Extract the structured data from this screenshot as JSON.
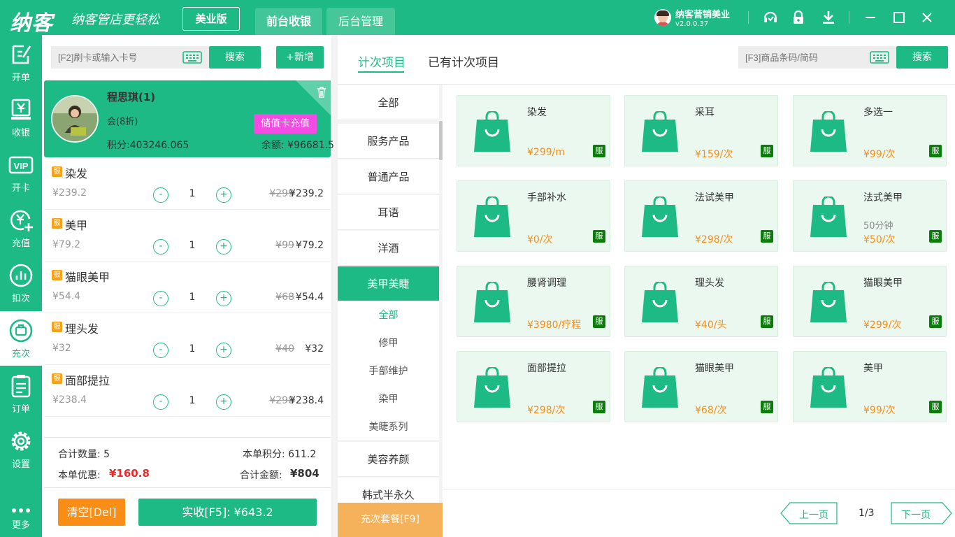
{
  "topbar": {
    "logo": "纳客",
    "slogan": "纳客管店更轻松",
    "edition": "美业版",
    "tabs": [
      {
        "label": "前台收银"
      },
      {
        "label": "后台管理"
      }
    ],
    "user_name": "纳客营销美业",
    "version": "v2.0.0.37"
  },
  "nav": [
    {
      "label": "开单",
      "icon": "edit-doc-icon"
    },
    {
      "label": "收银",
      "icon": "cash-icon"
    },
    {
      "label": "开卡",
      "icon": "vip-card-icon"
    },
    {
      "label": "充值",
      "icon": "recharge-icon"
    },
    {
      "label": "扣次",
      "icon": "chart-icon"
    },
    {
      "label": "充次",
      "icon": "refill-icon"
    },
    {
      "label": "订单",
      "icon": "order-icon"
    },
    {
      "label": "设置",
      "icon": "gear-icon"
    },
    {
      "label": "更多",
      "icon": "more-icon"
    }
  ],
  "cart": {
    "card_placeholder": "[F2]刷卡或输入卡号",
    "search_label": "搜索",
    "new_label": "+新增",
    "member": {
      "name": "程思琪(1)",
      "level": "会(8折)",
      "points": "积分:403246.065",
      "balance": "余额: ¥96681.5",
      "recharge_label": "储值卡充值"
    },
    "items": [
      {
        "badge": "服",
        "name": "染发",
        "price": "¥239.2",
        "qty": "1",
        "orig": "¥299",
        "final": "¥239.2"
      },
      {
        "badge": "服",
        "name": "美甲",
        "price": "¥79.2",
        "qty": "1",
        "orig": "¥99",
        "final": "¥79.2"
      },
      {
        "badge": "服",
        "name": "猫眼美甲",
        "price": "¥54.4",
        "qty": "1",
        "orig": "¥68",
        "final": "¥54.4"
      },
      {
        "badge": "服",
        "name": "理头发",
        "price": "¥32",
        "qty": "1",
        "orig": "¥40",
        "final": "¥32"
      },
      {
        "badge": "服",
        "name": "面部提拉",
        "price": "¥238.4",
        "qty": "1",
        "orig": "¥298",
        "final": "¥238.4"
      }
    ],
    "totals": {
      "qty": "合计数量: 5",
      "points": "本单积分: 611.2",
      "discount_label": "本单优惠:",
      "discount": "¥160.8",
      "total_label": "合计金额:",
      "total": "¥804"
    },
    "clear_label": "清空[Del]",
    "pay_label": "实收[F5]: ¥643.2"
  },
  "right": {
    "tabs": [
      {
        "label": "计次项目"
      },
      {
        "label": "已有计次项目"
      }
    ],
    "code_placeholder": "[F3]商品条码/简码",
    "search_label": "搜索",
    "categories": [
      {
        "label": "全部"
      },
      {
        "label": "服务产品"
      },
      {
        "label": "普通产品"
      },
      {
        "label": "耳语"
      },
      {
        "label": "洋酒"
      },
      {
        "label": "美甲美睫"
      }
    ],
    "subcategories": [
      {
        "label": "全部"
      },
      {
        "label": "修甲"
      },
      {
        "label": "手部维护"
      },
      {
        "label": "染甲"
      },
      {
        "label": "美睫系列"
      }
    ],
    "categories_after": [
      {
        "label": "美容养颜"
      },
      {
        "label": "韩式半永久"
      }
    ],
    "package_label": "充次套餐[F9]",
    "products": [
      {
        "name": "染发",
        "duration": "",
        "price": "¥299/m",
        "tag": "服"
      },
      {
        "name": "采耳",
        "duration": "",
        "price": "¥159/次",
        "tag": "服"
      },
      {
        "name": "多选一",
        "duration": "",
        "price": "¥99/次",
        "tag": "服"
      },
      {
        "name": "手部补水",
        "duration": "",
        "price": "¥0/次",
        "tag": "服"
      },
      {
        "name": "法试美甲",
        "duration": "",
        "price": "¥298/次",
        "tag": "服"
      },
      {
        "name": "法式美甲",
        "duration": "50分钟",
        "price": "¥50/次",
        "tag": "服"
      },
      {
        "name": "腰肾调理",
        "duration": "",
        "price": "¥3980/疗程",
        "tag": "服"
      },
      {
        "name": "理头发",
        "duration": "",
        "price": "¥40/头",
        "tag": "服"
      },
      {
        "name": "猫眼美甲",
        "duration": "",
        "price": "¥299/次",
        "tag": "服"
      },
      {
        "name": "面部提拉",
        "duration": "",
        "price": "¥298/次",
        "tag": "服"
      },
      {
        "name": "猫眼美甲",
        "duration": "",
        "price": "¥68/次",
        "tag": "服"
      },
      {
        "name": "美甲",
        "duration": "",
        "price": "¥99/次",
        "tag": "服"
      }
    ],
    "pager": {
      "prev": "上一页",
      "info": "1/3",
      "next": "下一页"
    }
  }
}
